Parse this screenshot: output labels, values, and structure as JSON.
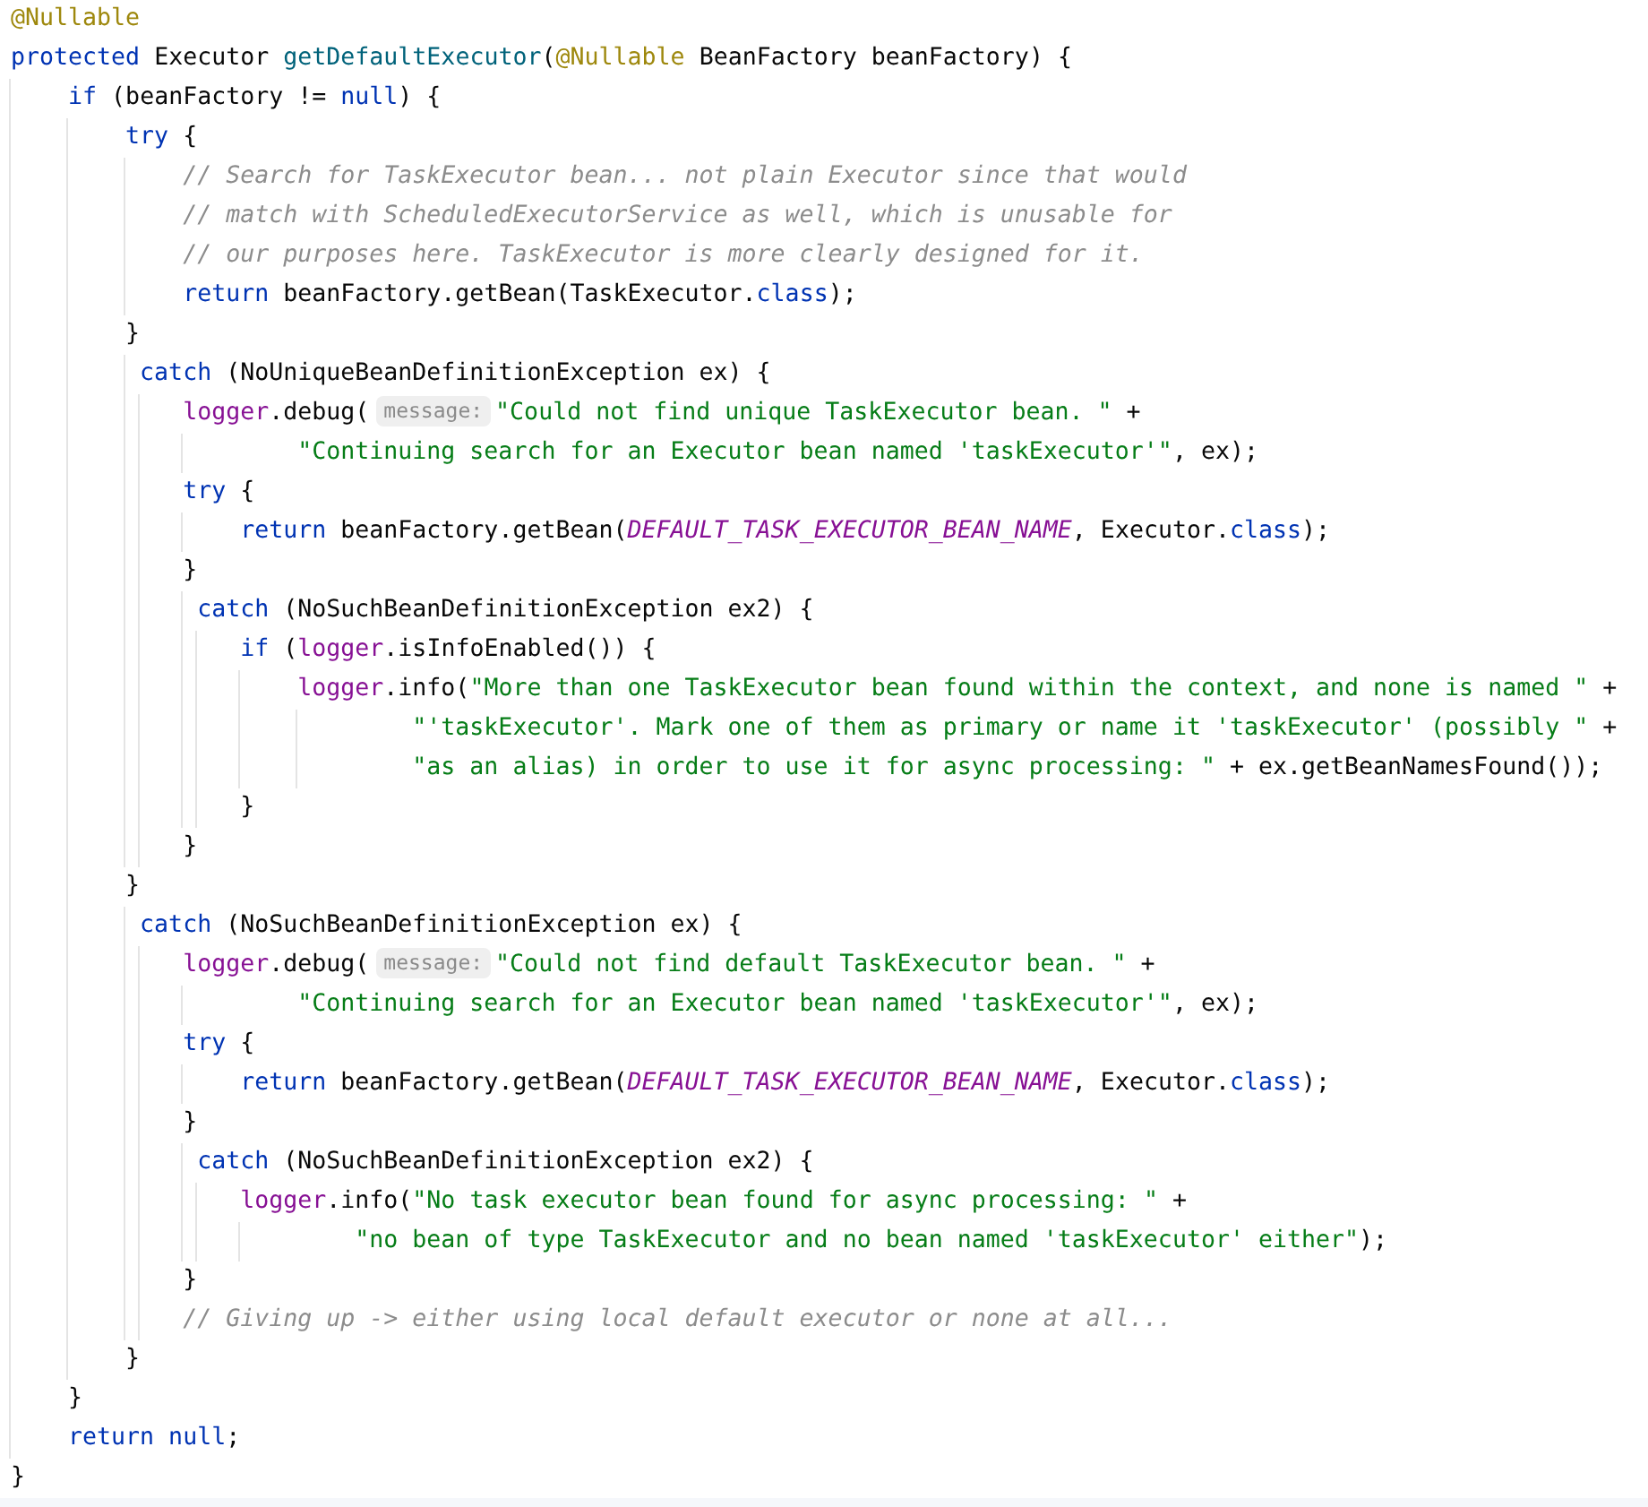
{
  "editor": {
    "lines": [
      {
        "tokens": [
          {
            "kind": "annotation",
            "text": "@Nullable"
          }
        ]
      },
      {
        "tokens": [
          {
            "kind": "keyword",
            "text": "protected"
          },
          {
            "kind": "plain",
            "text": " Executor "
          },
          {
            "kind": "method",
            "text": "getDefaultExecutor"
          },
          {
            "kind": "plain",
            "text": "("
          },
          {
            "kind": "annotation",
            "text": "@Nullable"
          },
          {
            "kind": "plain",
            "text": " BeanFactory beanFactory) {"
          }
        ]
      },
      {
        "tokens": [
          {
            "kind": "keyword",
            "text": "    if"
          },
          {
            "kind": "plain",
            "text": " (beanFactory != "
          },
          {
            "kind": "keyword",
            "text": "null"
          },
          {
            "kind": "plain",
            "text": ") {"
          }
        ]
      },
      {
        "tokens": [
          {
            "kind": "keyword",
            "text": "        try"
          },
          {
            "kind": "plain",
            "text": " {"
          }
        ]
      },
      {
        "tokens": [
          {
            "kind": "comment",
            "text": "            // Search for TaskExecutor bean... not plain Executor since that would"
          }
        ]
      },
      {
        "tokens": [
          {
            "kind": "comment",
            "text": "            // match with ScheduledExecutorService as well, which is unusable for"
          }
        ]
      },
      {
        "tokens": [
          {
            "kind": "comment",
            "text": "            // our purposes here. TaskExecutor is more clearly designed for it."
          }
        ]
      },
      {
        "tokens": [
          {
            "kind": "keyword",
            "text": "            return"
          },
          {
            "kind": "plain",
            "text": " beanFactory.getBean(TaskExecutor."
          },
          {
            "kind": "keyword",
            "text": "class"
          },
          {
            "kind": "plain",
            "text": ");"
          }
        ]
      },
      {
        "tokens": [
          {
            "kind": "plain",
            "text": "        }"
          }
        ]
      },
      {
        "tokens": [
          {
            "kind": "keyword",
            "text": "         catch"
          },
          {
            "kind": "plain",
            "text": " (NoUniqueBeanDefinitionException ex) {"
          }
        ]
      },
      {
        "tokens": [
          {
            "kind": "field",
            "text": "            logger"
          },
          {
            "kind": "plain",
            "text": ".debug("
          },
          {
            "kind": "hint",
            "text": "message:"
          },
          {
            "kind": "string",
            "text": "\"Could not find unique TaskExecutor bean. \""
          },
          {
            "kind": "plain",
            "text": " +"
          }
        ]
      },
      {
        "tokens": [
          {
            "kind": "string",
            "text": "                    \"Continuing search for an Executor bean named 'taskExecutor'\""
          },
          {
            "kind": "plain",
            "text": ", ex);"
          }
        ]
      },
      {
        "tokens": [
          {
            "kind": "keyword",
            "text": "            try"
          },
          {
            "kind": "plain",
            "text": " {"
          }
        ]
      },
      {
        "tokens": [
          {
            "kind": "keyword",
            "text": "                return"
          },
          {
            "kind": "plain",
            "text": " beanFactory.getBean("
          },
          {
            "kind": "constant",
            "text": "DEFAULT_TASK_EXECUTOR_BEAN_NAME"
          },
          {
            "kind": "plain",
            "text": ", Executor."
          },
          {
            "kind": "keyword",
            "text": "class"
          },
          {
            "kind": "plain",
            "text": ");"
          }
        ]
      },
      {
        "tokens": [
          {
            "kind": "plain",
            "text": "            }"
          }
        ]
      },
      {
        "tokens": [
          {
            "kind": "keyword",
            "text": "             catch"
          },
          {
            "kind": "plain",
            "text": " (NoSuchBeanDefinitionException ex2) {"
          }
        ]
      },
      {
        "tokens": [
          {
            "kind": "keyword",
            "text": "                if"
          },
          {
            "kind": "plain",
            "text": " ("
          },
          {
            "kind": "field",
            "text": "logger"
          },
          {
            "kind": "plain",
            "text": ".isInfoEnabled()) {"
          }
        ]
      },
      {
        "tokens": [
          {
            "kind": "field",
            "text": "                    logger"
          },
          {
            "kind": "plain",
            "text": ".info("
          },
          {
            "kind": "string",
            "text": "\"More than one TaskExecutor bean found within the context, and none is named \""
          },
          {
            "kind": "plain",
            "text": " +"
          }
        ]
      },
      {
        "tokens": [
          {
            "kind": "string",
            "text": "                            \"'taskExecutor'. Mark one of them as primary or name it 'taskExecutor' (possibly \""
          },
          {
            "kind": "plain",
            "text": " +"
          }
        ]
      },
      {
        "tokens": [
          {
            "kind": "string",
            "text": "                            \"as an alias) in order to use it for async processing: \""
          },
          {
            "kind": "plain",
            "text": " + ex.getBeanNamesFound());"
          }
        ]
      },
      {
        "tokens": [
          {
            "kind": "plain",
            "text": "                }"
          }
        ]
      },
      {
        "tokens": [
          {
            "kind": "plain",
            "text": "            }"
          }
        ]
      },
      {
        "tokens": [
          {
            "kind": "plain",
            "text": "        }"
          }
        ]
      },
      {
        "tokens": [
          {
            "kind": "keyword",
            "text": "         catch"
          },
          {
            "kind": "plain",
            "text": " (NoSuchBeanDefinitionException ex) {"
          }
        ]
      },
      {
        "tokens": [
          {
            "kind": "field",
            "text": "            logger"
          },
          {
            "kind": "plain",
            "text": ".debug("
          },
          {
            "kind": "hint",
            "text": "message:"
          },
          {
            "kind": "string",
            "text": "\"Could not find default TaskExecutor bean. \""
          },
          {
            "kind": "plain",
            "text": " +"
          }
        ]
      },
      {
        "tokens": [
          {
            "kind": "string",
            "text": "                    \"Continuing search for an Executor bean named 'taskExecutor'\""
          },
          {
            "kind": "plain",
            "text": ", ex);"
          }
        ]
      },
      {
        "tokens": [
          {
            "kind": "keyword",
            "text": "            try"
          },
          {
            "kind": "plain",
            "text": " {"
          }
        ]
      },
      {
        "tokens": [
          {
            "kind": "keyword",
            "text": "                return"
          },
          {
            "kind": "plain",
            "text": " beanFactory.getBean("
          },
          {
            "kind": "constant",
            "text": "DEFAULT_TASK_EXECUTOR_BEAN_NAME"
          },
          {
            "kind": "plain",
            "text": ", Executor."
          },
          {
            "kind": "keyword",
            "text": "class"
          },
          {
            "kind": "plain",
            "text": ");"
          }
        ]
      },
      {
        "tokens": [
          {
            "kind": "plain",
            "text": "            }"
          }
        ]
      },
      {
        "tokens": [
          {
            "kind": "keyword",
            "text": "             catch"
          },
          {
            "kind": "plain",
            "text": " (NoSuchBeanDefinitionException ex2) {"
          }
        ]
      },
      {
        "tokens": [
          {
            "kind": "field",
            "text": "                logger"
          },
          {
            "kind": "plain",
            "text": ".info("
          },
          {
            "kind": "string",
            "text": "\"No task executor bean found for async processing: \""
          },
          {
            "kind": "plain",
            "text": " +"
          }
        ]
      },
      {
        "tokens": [
          {
            "kind": "string",
            "text": "                        \"no bean of type TaskExecutor and no bean named 'taskExecutor' either\""
          },
          {
            "kind": "plain",
            "text": ");"
          }
        ]
      },
      {
        "tokens": [
          {
            "kind": "plain",
            "text": "            }"
          }
        ]
      },
      {
        "tokens": [
          {
            "kind": "comment",
            "text": "            // Giving up -> either using local default executor or none at all..."
          }
        ]
      },
      {
        "tokens": [
          {
            "kind": "plain",
            "text": "        }"
          }
        ]
      },
      {
        "tokens": [
          {
            "kind": "plain",
            "text": "    }"
          }
        ]
      },
      {
        "tokens": [
          {
            "kind": "keyword",
            "text": "    return null"
          },
          {
            "kind": "plain",
            "text": ";"
          }
        ]
      },
      {
        "tokens": [
          {
            "kind": "plain",
            "text": "}"
          }
        ]
      }
    ]
  }
}
